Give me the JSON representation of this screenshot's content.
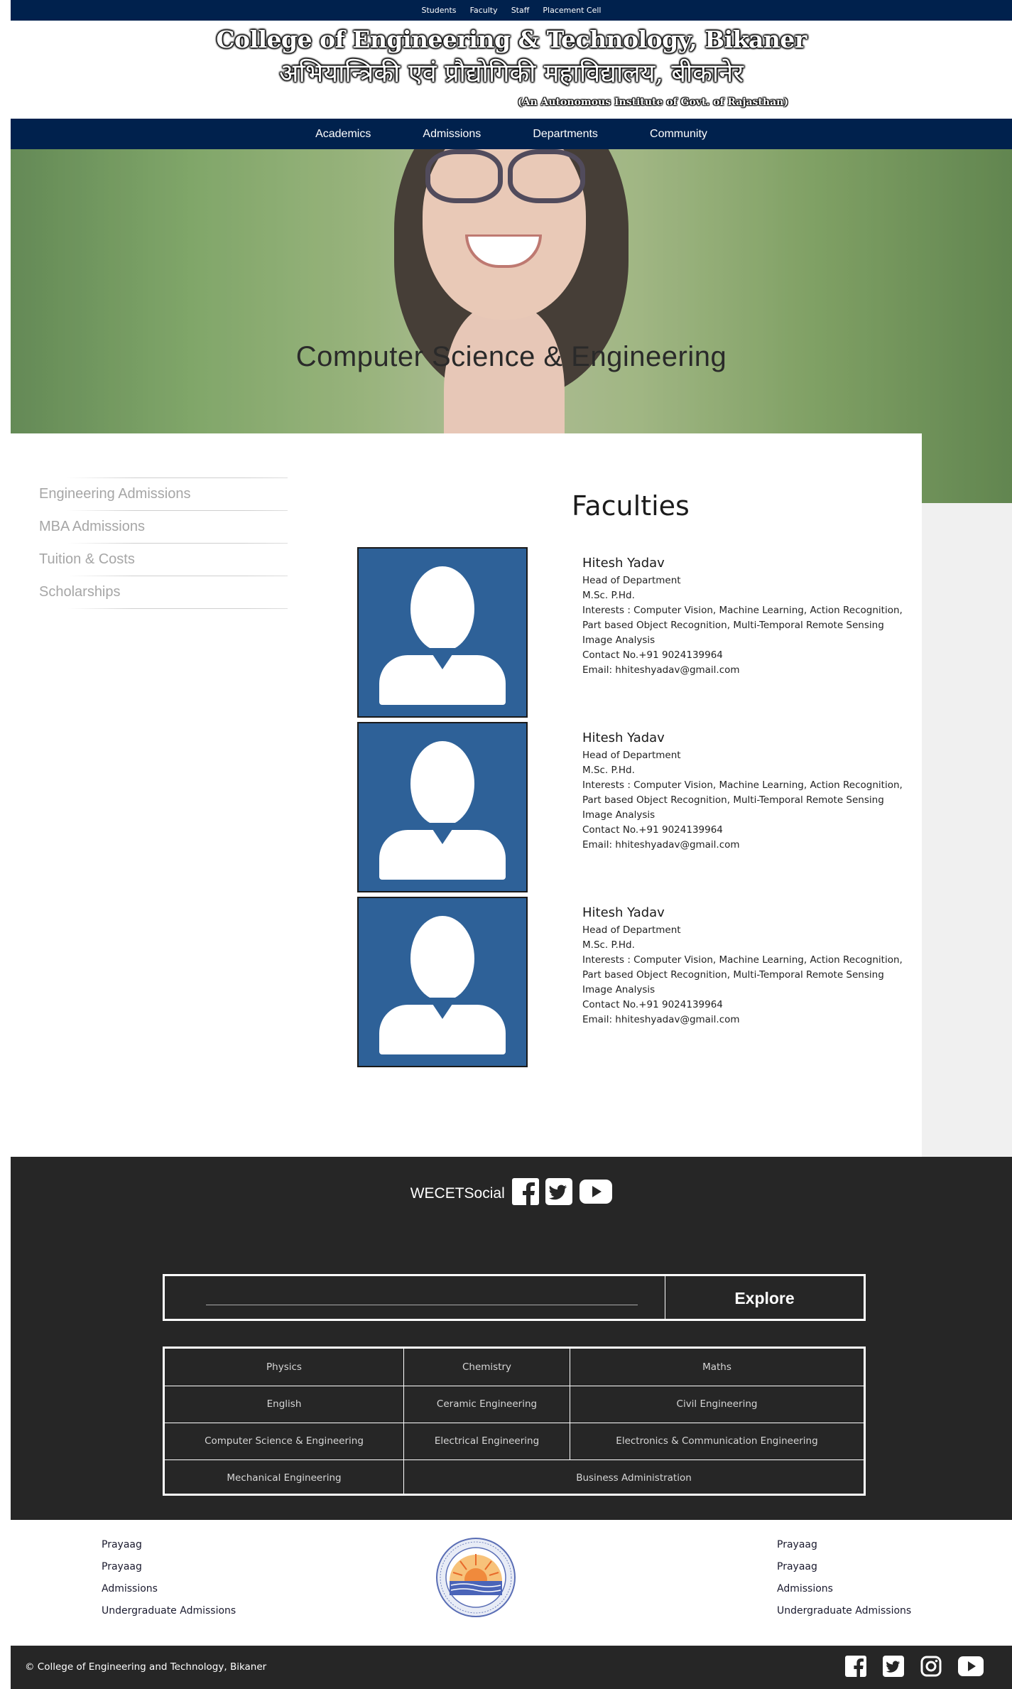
{
  "topbar": {
    "links": [
      "Students",
      "Faculty",
      "Staff",
      "Placement Cell"
    ]
  },
  "header": {
    "title_en": "College of Engineering & Technology, Bikaner",
    "title_hi": "अभियान्त्रिकी एवं प्रौद्योगिकी महाविद्यालय, बीकानेर",
    "subtitle": "(An Autonomous Institute of Govt. of Rajasthan)"
  },
  "nav": {
    "items": [
      "Academics",
      "Admissions",
      "Departments",
      "Community"
    ]
  },
  "hero": {
    "title": "Computer Science & Engineering"
  },
  "sidebar": {
    "items": [
      "Engineering Admissions",
      "MBA Admissions",
      "Tuition & Costs",
      "Scholarships"
    ]
  },
  "faculties": {
    "title": "Faculties",
    "members": [
      {
        "name": "Hitesh Yadav",
        "role": "Head of Department",
        "degree": "M.Sc. P.Hd.",
        "interests_1": "Interests : Computer Vision, Machine Learning, Action Recognition,",
        "interests_2": "Part based Object Recognition, Multi-Temporal Remote Sensing",
        "interests_3": "Image Analysis",
        "contact": "Contact No.+91 9024139964",
        "email": "Email: hhiteshyadav@gmail.com"
      },
      {
        "name": "Hitesh Yadav",
        "role": "Head of Department",
        "degree": "M.Sc. P.Hd.",
        "interests_1": "Interests : Computer Vision, Machine Learning, Action Recognition,",
        "interests_2": "Part based Object Recognition, Multi-Temporal Remote Sensing",
        "interests_3": "Image Analysis",
        "contact": "Contact No.+91 9024139964",
        "email": "Email: hhiteshyadav@gmail.com"
      },
      {
        "name": "Hitesh Yadav",
        "role": "Head of Department",
        "degree": "M.Sc. P.Hd.",
        "interests_1": "Interests : Computer Vision, Machine Learning, Action Recognition,",
        "interests_2": "Part based Object Recognition, Multi-Temporal Remote Sensing",
        "interests_3": "Image Analysis",
        "contact": "Contact No.+91 9024139964",
        "email": "Email: hhiteshyadav@gmail.com"
      }
    ]
  },
  "footer": {
    "social_label": "WECETSocial",
    "social_icons": [
      "facebook-icon",
      "twitter-icon",
      "youtube-icon"
    ],
    "search_placeholder": "",
    "explore_label": "Explore",
    "departments": [
      "Physics",
      "Chemistry",
      "Maths",
      "English",
      "Ceramic Engineering",
      "Civil Engineering",
      "Computer Science & Engineering",
      "Electrical Engineering",
      "Electronics & Communication Engineering",
      "Mechanical Engineering",
      "Business Administration"
    ]
  },
  "bottom": {
    "left_links": [
      "Prayaag",
      "Prayaag",
      "Admissions",
      "Undergraduate Admissions"
    ],
    "right_links": [
      "Prayaag",
      "Prayaag",
      "Admissions",
      "Undergraduate Admissions"
    ]
  },
  "copyright": {
    "text": "© College of Engineering and Technology, Bikaner",
    "icons": [
      "facebook-icon",
      "twitter-icon",
      "instagram-icon",
      "youtube-icon"
    ]
  },
  "colors": {
    "navy": "#00214d",
    "dark_footer": "#262626",
    "avatar_blue": "#2e6198",
    "sidebar_text": "#a6a6a6"
  }
}
